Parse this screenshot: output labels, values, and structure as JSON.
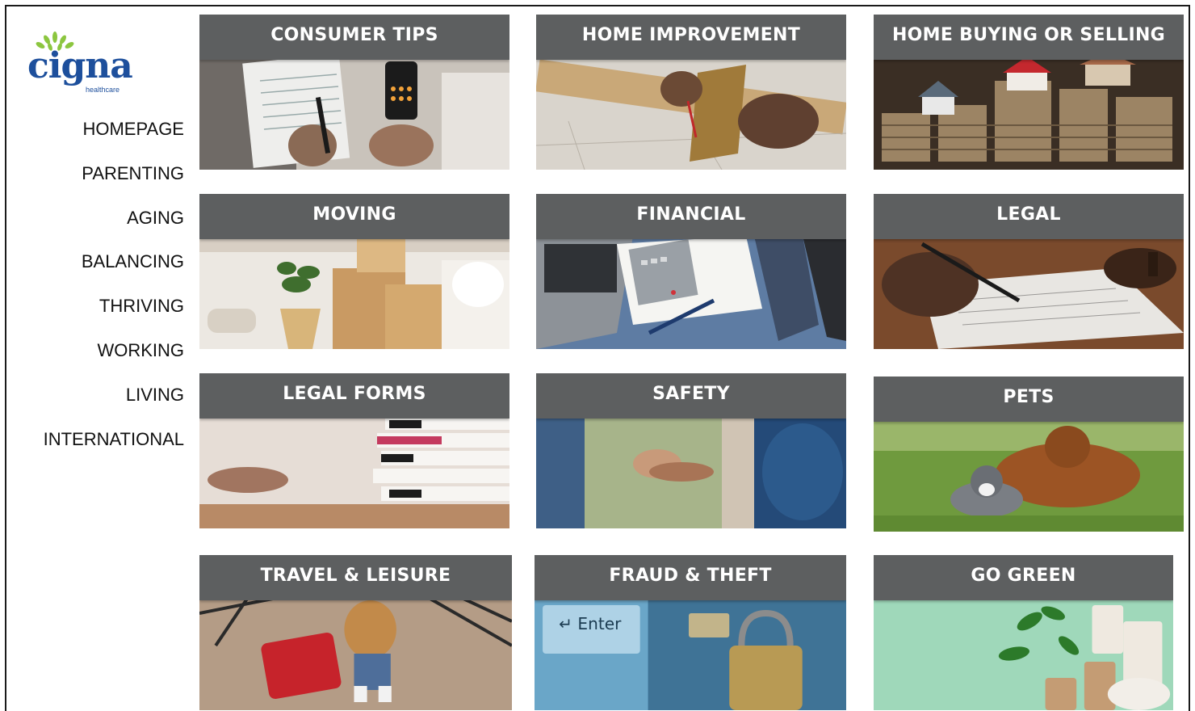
{
  "logo": {
    "text": "cigna",
    "subtext": "healthcare",
    "color": "#1d4f9c",
    "leaf_color": "#8cc63f"
  },
  "nav": {
    "items": [
      {
        "label": "HOMEPAGE"
      },
      {
        "label": "PARENTING"
      },
      {
        "label": "AGING"
      },
      {
        "label": "BALANCING"
      },
      {
        "label": "THRIVING"
      },
      {
        "label": "WORKING"
      },
      {
        "label": "LIVING"
      },
      {
        "label": "INTERNATIONAL"
      }
    ]
  },
  "tiles": [
    {
      "title": "CONSUMER TIPS",
      "image": "calculator-paperwork-photo"
    },
    {
      "title": "HOME IMPROVEMENT",
      "image": "carpentry-measuring-photo"
    },
    {
      "title": "HOME BUYING OR SELLING",
      "image": "houses-on-coins-photo"
    },
    {
      "title": "MOVING",
      "image": "moving-boxes-photo"
    },
    {
      "title": "FINANCIAL",
      "image": "laptop-calculator-desk-photo"
    },
    {
      "title": "LEGAL",
      "image": "signing-document-photo"
    },
    {
      "title": "LEGAL FORMS",
      "image": "stacked-files-photo"
    },
    {
      "title": "SAFETY",
      "image": "holding-hands-child-photo"
    },
    {
      "title": "PETS",
      "image": "dog-and-cat-grass-photo"
    },
    {
      "title": "TRAVEL & LEISURE",
      "image": "child-with-suitcase-photo"
    },
    {
      "title": "FRAUD & THEFT",
      "image": "padlock-card-keyboard-photo"
    },
    {
      "title": "GO GREEN",
      "image": "eco-cups-plant-photo"
    }
  ],
  "colors": {
    "tile_header": "#5d5f60",
    "nav_text": "#111111"
  }
}
